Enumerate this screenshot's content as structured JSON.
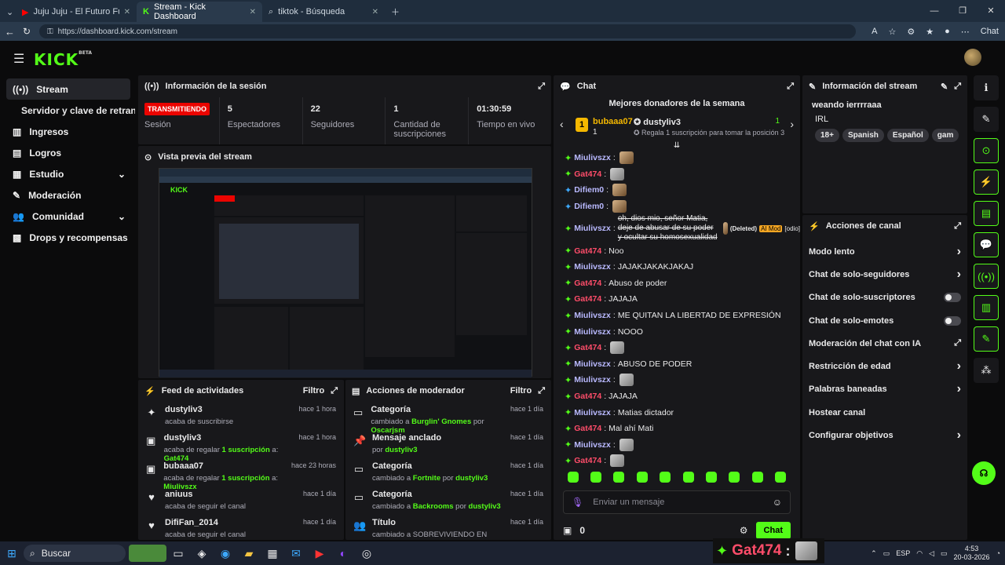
{
  "browser": {
    "tabs": [
      {
        "label": "Juju Juju - El Futuro Fuera De Orbi"
      },
      {
        "label": "Stream - Kick Dashboard"
      },
      {
        "label": "tiktok - Búsqueda"
      }
    ],
    "url": "https://dashboard.kick.com/stream",
    "chat_label": "Chat"
  },
  "app": {
    "logo": "KICK",
    "logo_sup": "BETA"
  },
  "sidebar": {
    "items": [
      {
        "label": "Stream"
      },
      {
        "label": "Servidor y clave de retransm"
      },
      {
        "label": "Ingresos"
      },
      {
        "label": "Logros"
      },
      {
        "label": "Estudio"
      },
      {
        "label": "Moderación"
      },
      {
        "label": "Comunidad"
      },
      {
        "label": "Drops y recompensas"
      }
    ]
  },
  "session": {
    "title": "Información de la sesión",
    "stats": [
      {
        "value": "TRANSMITIENDO",
        "label": "Sesión"
      },
      {
        "value": "5",
        "label": "Espectadores"
      },
      {
        "value": "22",
        "label": "Seguidores"
      },
      {
        "value": "1",
        "label": "Cantidad de suscripciones"
      },
      {
        "value": "01:30:59",
        "label": "Tiempo en vivo"
      }
    ]
  },
  "preview": {
    "title": "Vista previa del stream"
  },
  "feed": {
    "title": "Feed de actividades",
    "filter": "Filtro",
    "items": [
      {
        "name": "dustyliv3",
        "time": "hace 1 hora",
        "sub": "acaba de suscribirse",
        "icon": "✦"
      },
      {
        "name": "dustyliv3",
        "time": "hace 1 hora",
        "sub": "acaba de regalar 1 suscripción a: Gat474",
        "icon": "▣"
      },
      {
        "name": "bubaaa07",
        "time": "hace 23 horas",
        "sub": "acaba de regalar 1 suscripción a: Miulivszx",
        "icon": "▣"
      },
      {
        "name": "aniuus",
        "time": "hace 1 día",
        "sub": "acaba de seguir el canal",
        "icon": "♥"
      },
      {
        "name": "DifiFan_2014",
        "time": "hace 1 día",
        "sub": "acaba de seguir el canal",
        "icon": "♥"
      }
    ]
  },
  "modactions": {
    "title": "Acciones de moderador",
    "filter": "Filtro",
    "items": [
      {
        "name": "Categoría",
        "time": "hace 1 día",
        "sub": "cambiado a Burglin' Gnomes por Oscarjsm",
        "icon": "▭"
      },
      {
        "name": "Mensaje anclado",
        "time": "hace 1 día",
        "sub": "por dustyliv3",
        "icon": "📌"
      },
      {
        "name": "Categoría",
        "time": "hace 1 día",
        "sub": "cambiado a Fortnite por dustyliv3",
        "icon": "▭"
      },
      {
        "name": "Categoría",
        "time": "hace 1 día",
        "sub": "cambiado a Backrooms por dustyliv3",
        "icon": "▭"
      },
      {
        "name": "Título",
        "time": "hace 1 día",
        "sub": "cambiado a SOBREVIVIENDO EN LOS BACKROOMS por",
        "icon": "👥"
      }
    ]
  },
  "chat": {
    "title": "Chat",
    "donors_title": "Mejores donadores de la semana",
    "donor1": "bubaaa07",
    "donor1_count": "1",
    "donor2": "dustyliv3",
    "donor2_count": "1",
    "donor_cta": "Regala 1 suscripción para tomar la posición 3",
    "messages": [
      {
        "user": "Miulivszx",
        "color": "#b9b9ff",
        "text": "",
        "emote": "dog",
        "badge": "g"
      },
      {
        "user": "Gat474",
        "color": "#ff4d6a",
        "text": "",
        "emote": "cat",
        "badge": "g"
      },
      {
        "user": "Difiem0",
        "color": "#b9b9ff",
        "text": "",
        "emote": "dog",
        "badge": "b"
      },
      {
        "user": "Difiem0",
        "color": "#b9b9ff",
        "text": "",
        "emote": "dog",
        "badge": "b"
      },
      {
        "user": "Miulivszx",
        "color": "#b9b9ff",
        "text": "oh, dios mio, señor Matia, deje de abusar de su poder y ocultar su homosexualidad",
        "emote": "",
        "badge": "g",
        "deleted": true
      },
      {
        "user": "Gat474",
        "color": "#ff4d6a",
        "text": "Noo",
        "emote": "",
        "badge": "g"
      },
      {
        "user": "Miulivszx",
        "color": "#b9b9ff",
        "text": "JAJAKJAKAKJAKAJ",
        "emote": "",
        "badge": "g"
      },
      {
        "user": "Gat474",
        "color": "#ff4d6a",
        "text": "Abuso de poder",
        "emote": "",
        "badge": "g"
      },
      {
        "user": "Gat474",
        "color": "#ff4d6a",
        "text": "JAJAJA",
        "emote": "",
        "badge": "g"
      },
      {
        "user": "Miulivszx",
        "color": "#b9b9ff",
        "text": "ME QUITAN LA LIBERTAD DE EXPRESIÓN",
        "emote": "",
        "badge": "g"
      },
      {
        "user": "Miulivszx",
        "color": "#b9b9ff",
        "text": "NOOO",
        "emote": "",
        "badge": "g"
      },
      {
        "user": "Gat474",
        "color": "#ff4d6a",
        "text": "",
        "emote": "cat",
        "badge": "g"
      },
      {
        "user": "Miulivszx",
        "color": "#b9b9ff",
        "text": "ABUSO DE PODER",
        "emote": "",
        "badge": "g"
      },
      {
        "user": "Miulivszx",
        "color": "#b9b9ff",
        "text": "",
        "emote": "cat",
        "badge": "g"
      },
      {
        "user": "Gat474",
        "color": "#ff4d6a",
        "text": "JAJAJA",
        "emote": "",
        "badge": "g"
      },
      {
        "user": "Miulivszx",
        "color": "#b9b9ff",
        "text": "Matias dictador",
        "emote": "",
        "badge": "g"
      },
      {
        "user": "Gat474",
        "color": "#ff4d6a",
        "text": "Mal ahí Mati",
        "emote": "",
        "badge": "g"
      },
      {
        "user": "Miulivszx",
        "color": "#b9b9ff",
        "text": "",
        "emote": "cat",
        "badge": "g"
      },
      {
        "user": "Gat474",
        "color": "#ff4d6a",
        "text": "",
        "emote": "cat",
        "badge": "g"
      }
    ],
    "deleted_label": "(Deleted)",
    "aimod_label": "AI Mod",
    "odio_label": "[odio]",
    "input_placeholder": "Enviar un mensaje",
    "points": "0",
    "send": "Chat"
  },
  "streaminfo": {
    "title": "Información del stream",
    "stream_title": "weando ierrrraaa",
    "category": "IRL",
    "tags": [
      "18+",
      "Spanish",
      "Español",
      "gam"
    ]
  },
  "channel": {
    "title": "Acciones de canal",
    "items": [
      {
        "label": "Modo lento",
        "type": "chev"
      },
      {
        "label": "Chat de solo-seguidores",
        "type": "chev"
      },
      {
        "label": "Chat de solo-suscriptores",
        "type": "toggle"
      },
      {
        "label": "Chat de solo-emotes",
        "type": "toggle"
      },
      {
        "label": "Moderación del chat con IA",
        "type": "ext"
      },
      {
        "label": "Restricción de edad",
        "type": "chev"
      },
      {
        "label": "Palabras baneadas",
        "type": "chev"
      },
      {
        "label": "Hostear canal",
        "type": "none"
      },
      {
        "label": "Configurar objetivos",
        "type": "chev"
      }
    ]
  },
  "overlay": {
    "user": "Gat474",
    "sep": ":"
  },
  "taskbar": {
    "search": "Buscar",
    "lang": "ESP",
    "time": "4:53",
    "date": "20-03-2026"
  }
}
